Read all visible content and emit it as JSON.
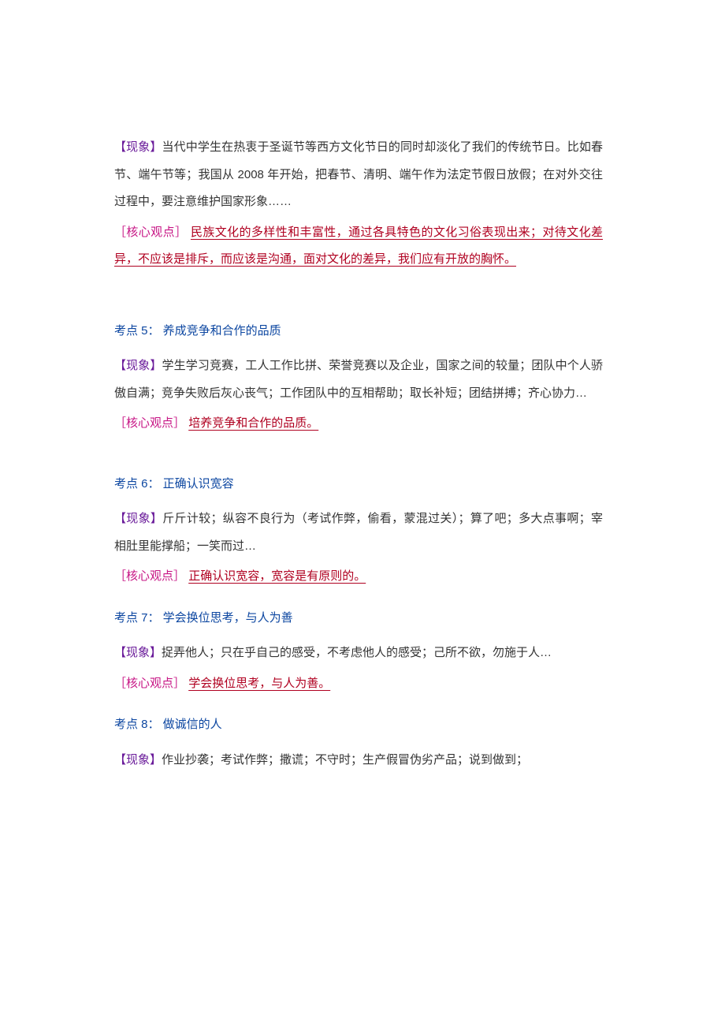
{
  "sections": [
    {
      "phenom_tag": "【现象】",
      "phenom_text": "当代中学生在热衷于圣诞节等西方文化节日的同时却淡化了我们的传统节日。比如春节、端午节等；我国从 2008 年开始，把春节、清明、端午作为法定节假日放假；在对外交往过程中，要注意维护国家形象……",
      "core_tag": "［核心观点］",
      "core_text": "民族文化的多样性和丰富性，通过各具特色的文化习俗表现出来；对待文化差异，不应该是排斥，而应该是沟通，面对文化的差异，我们应有开放的胸怀。"
    },
    {
      "title": "考点 5： 养成竞争和合作的品质",
      "phenom_tag": "【现象】",
      "phenom_text": "学生学习竞赛，工人工作比拼、荣誉竞赛以及企业，国家之间的较量；团队中个人骄傲自满；竞争失败后灰心丧气；工作团队中的互相帮助；取长补短；团结拼搏；齐心协力…",
      "core_tag": "［核心观点］",
      "core_text": "培养竞争和合作的品质。"
    },
    {
      "title": "考点 6： 正确认识宽容",
      "phenom_tag": "【现象】",
      "phenom_text": "斤斤计较；纵容不良行为（考试作弊，偷看，蒙混过关）；算了吧；多大点事啊；宰相肚里能撑船；一笑而过…",
      "core_tag": "［核心观点］",
      "core_text": "正确认识宽容，宽容是有原则的。"
    },
    {
      "title": "考点 7： 学会换位思考，与人为善",
      "phenom_tag": "【现象】",
      "phenom_text": "捉弄他人；只在乎自己的感受，不考虑他人的感受；己所不欲，勿施于人…",
      "core_tag": "［核心观点］",
      "core_text": "学会换位思考，与人为善。"
    },
    {
      "title": "考点 8： 做诚信的人",
      "phenom_tag": "【现象】",
      "phenom_text": "作业抄袭；考试作弊；撒谎；不守时；生产假冒伪劣产品；说到做到；"
    }
  ]
}
